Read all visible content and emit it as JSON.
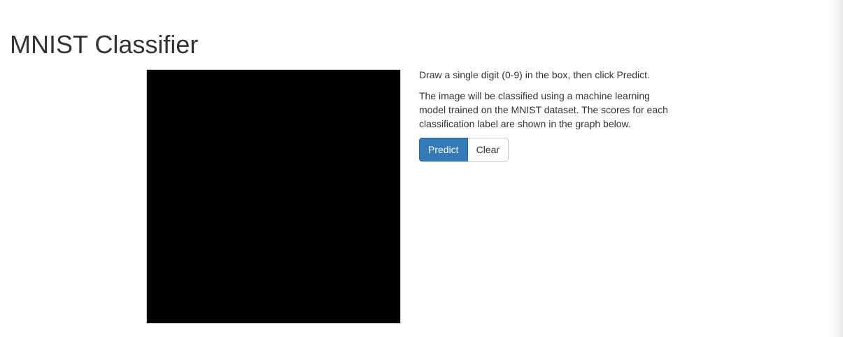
{
  "header": {
    "title": "MNIST Classifier"
  },
  "instructions": {
    "line1": "Draw a single digit (0-9) in the box, then click Predict.",
    "line2": "The image will be classified using a machine learning model trained on the MNIST dataset. The scores for each classification label are shown in the graph below."
  },
  "buttons": {
    "predict_label": "Predict",
    "clear_label": "Clear"
  },
  "colors": {
    "primary": "#337ab7",
    "canvas": "#000000"
  }
}
